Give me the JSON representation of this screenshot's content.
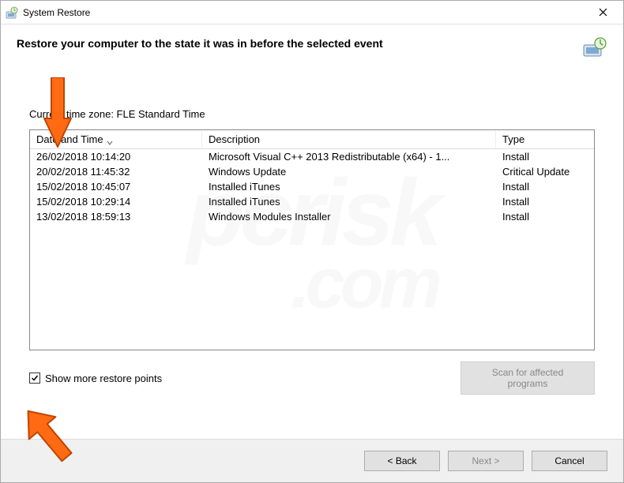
{
  "titlebar": {
    "title": "System Restore"
  },
  "header": {
    "heading": "Restore your computer to the state it was in before the selected event"
  },
  "timezone_label": "Current time zone: FLE Standard Time",
  "columns": {
    "date": "Date and Time",
    "desc": "Description",
    "type": "Type"
  },
  "rows": [
    {
      "date": "26/02/2018 10:14:20",
      "desc": "Microsoft Visual C++ 2013 Redistributable (x64) - 1...",
      "type": "Install"
    },
    {
      "date": "20/02/2018 11:45:32",
      "desc": "Windows Update",
      "type": "Critical Update"
    },
    {
      "date": "15/02/2018 10:45:07",
      "desc": "Installed iTunes",
      "type": "Install"
    },
    {
      "date": "15/02/2018 10:29:14",
      "desc": "Installed iTunes",
      "type": "Install"
    },
    {
      "date": "13/02/2018 18:59:13",
      "desc": "Windows Modules Installer",
      "type": "Install"
    }
  ],
  "checkbox": {
    "label": "Show more restore points",
    "checked": true
  },
  "scan_button": "Scan for affected programs",
  "footer": {
    "back": "< Back",
    "next": "Next >",
    "cancel": "Cancel"
  },
  "watermark": {
    "line1": "pcrisk",
    "line2": ".com"
  }
}
